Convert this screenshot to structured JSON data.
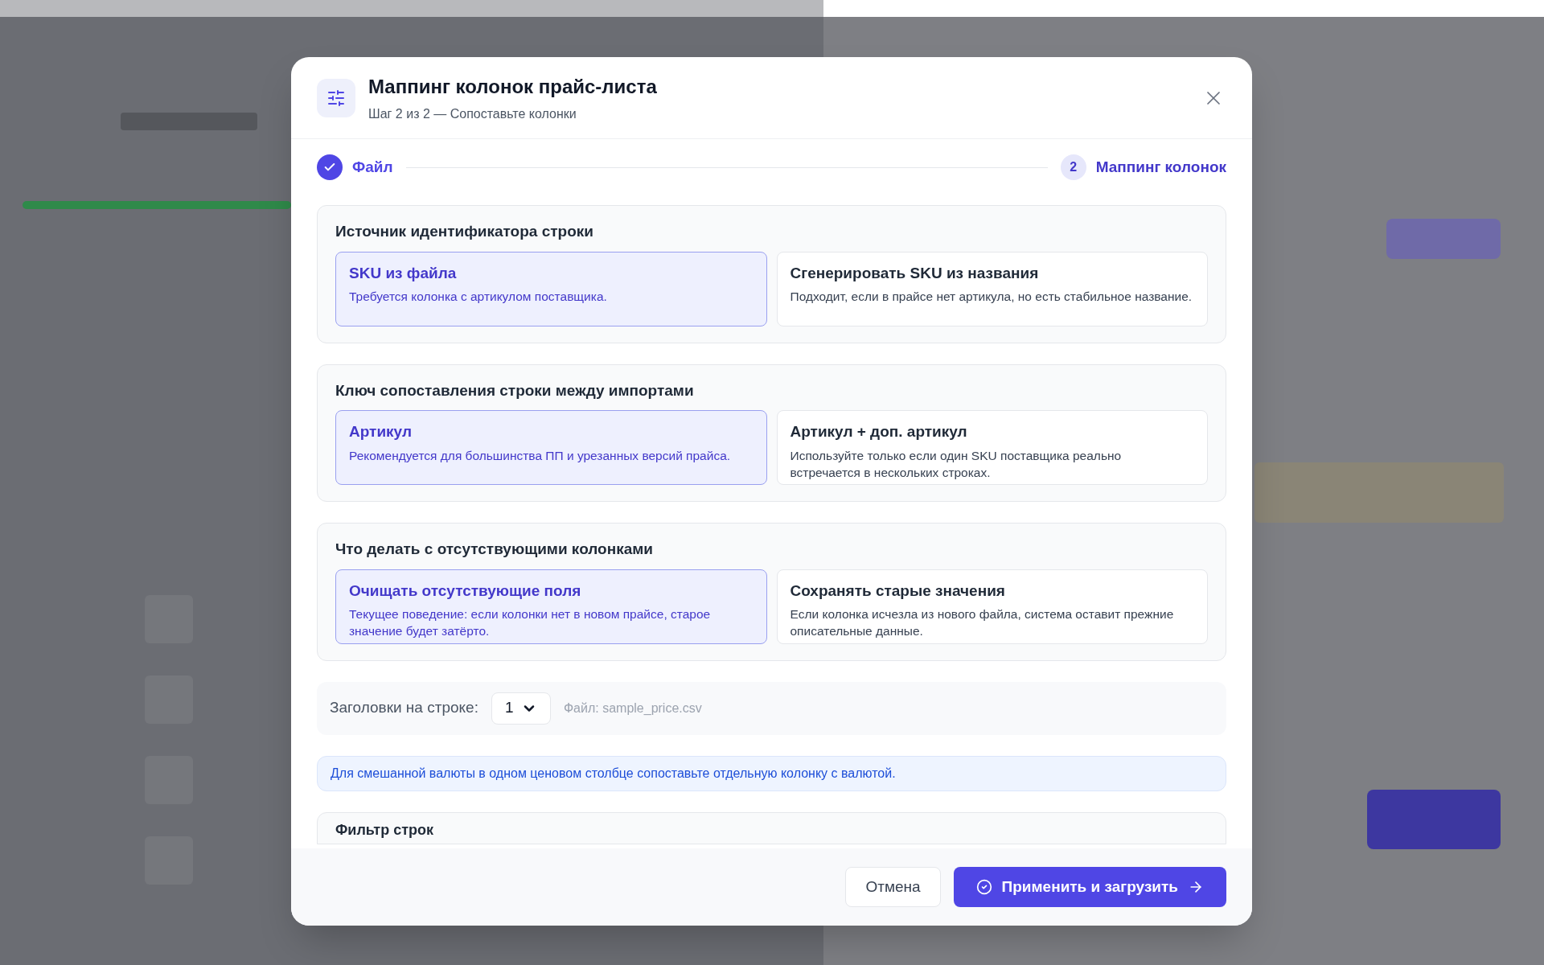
{
  "dialog": {
    "title": "Маппинг колонок прайс-листа",
    "subtitle": "Шаг 2 из 2 — Сопоставьте колонки",
    "steps": [
      {
        "label": "Файл",
        "completed": true,
        "selected": false
      },
      {
        "label": "Маппинг колонок",
        "number": "2",
        "completed": false,
        "selected": true
      }
    ],
    "sections": [
      {
        "title": "Источник идентификатора строки",
        "options": [
          {
            "title": "SKU из файла",
            "description": "Требуется колонка с артикулом поставщика.",
            "selected": true
          },
          {
            "title": "Сгенерировать SKU из названия",
            "description": "Подходит, если в прайсе нет артикула, но есть стабильное название.",
            "selected": false
          }
        ]
      },
      {
        "title": "Ключ сопоставления строки между импортами",
        "options": [
          {
            "title": "Артикул",
            "description": "Рекомендуется для большинства ПП и урезанных версий прайса.",
            "selected": true
          },
          {
            "title": "Артикул + доп. артикул",
            "description": "Используйте только если один SKU поставщика реально встречается в нескольких строках.",
            "selected": false
          }
        ]
      },
      {
        "title": "Что делать с отсутствующими колонками",
        "options": [
          {
            "title": "Очищать отсутствующие поля",
            "description": "Текущее поведение: если колонки нет в новом прайсе, старое значение будет затёрто.",
            "selected": true
          },
          {
            "title": "Сохранять старые значения",
            "description": "Если колонка исчезла из нового файла, система оставит прежние описательные данные.",
            "selected": false
          }
        ]
      }
    ],
    "header_row": {
      "label": "Заголовки на строке:",
      "value": "1",
      "file": "Файл: sample_price.csv"
    },
    "notice": "Для смешанной валюты в одном ценовом столбце сопоставьте отдельную колонку с валютой.",
    "filter_section": {
      "title": "Фильтр строк"
    },
    "buttons": [
      {
        "label": "Отмена",
        "kind": "secondary"
      },
      {
        "label": "Применить и загрузить",
        "kind": "primary"
      }
    ]
  }
}
